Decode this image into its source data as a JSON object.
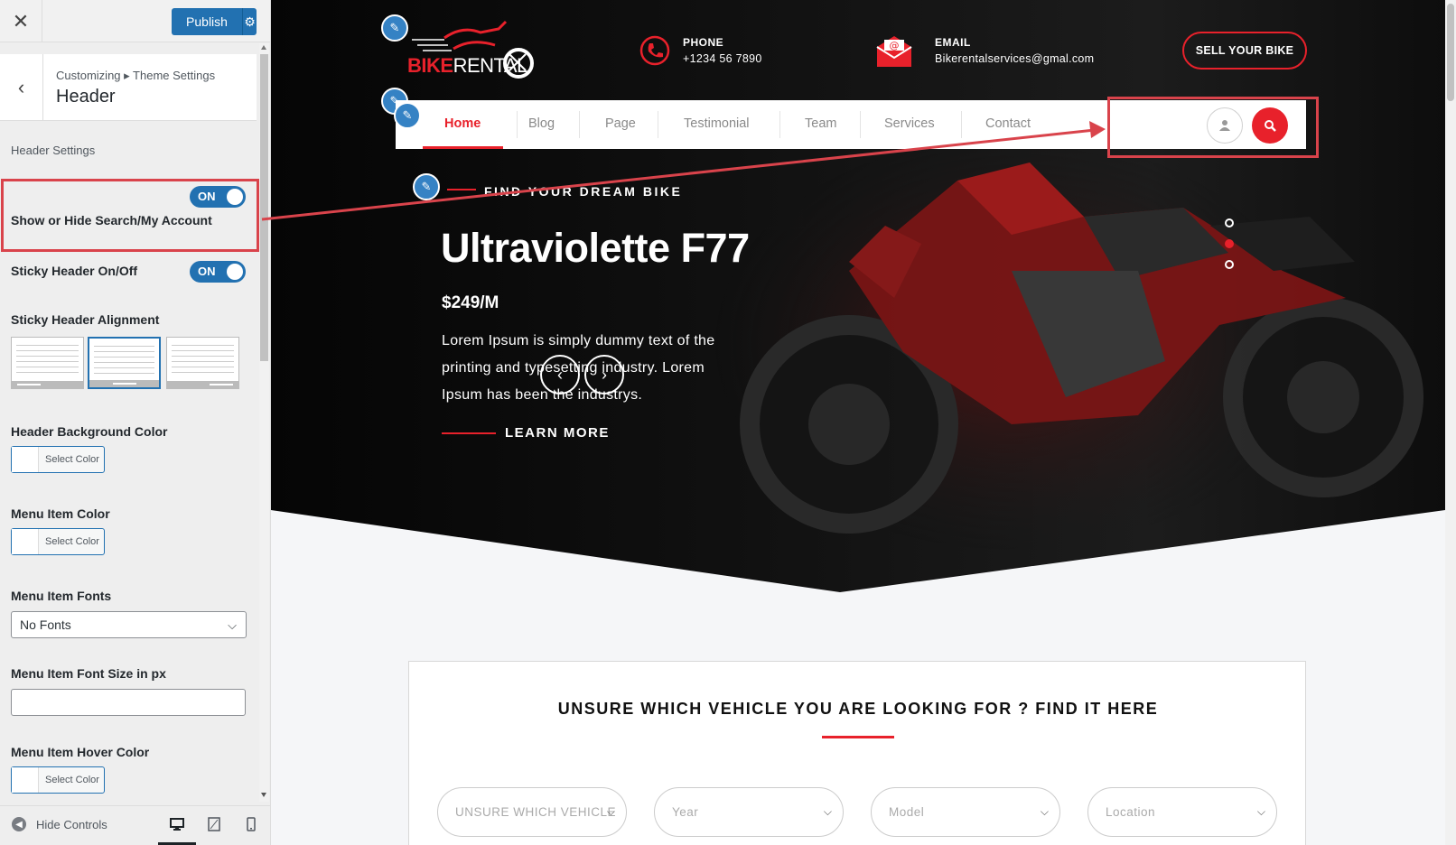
{
  "sidebar": {
    "close_icon": "close-icon",
    "publish_label": "Publish",
    "publish_gear_icon": "gear-icon",
    "breadcrumb": "Customizing ▸ Theme Settings",
    "section_title": "Header",
    "group_label": "Header Settings",
    "show_hide_toggle": {
      "label": "Show or Hide Search/My Account",
      "state": "ON"
    },
    "sticky_toggle": {
      "label": "Sticky Header On/Off",
      "state": "ON"
    },
    "sticky_alignment_label": "Sticky Header Alignment",
    "sticky_alignment_selected": "center",
    "bg_color_label": "Header Background Color",
    "menu_color_label": "Menu Item Color",
    "menu_fonts_label": "Menu Item Fonts",
    "menu_fonts_value": "No Fonts",
    "menu_font_size_label": "Menu Item Font Size in px",
    "menu_font_size_value": "",
    "menu_hover_label": "Menu Item Hover Color",
    "select_color_label": "Select Color",
    "hide_controls_label": "Hide Controls"
  },
  "preview": {
    "logo": {
      "part1": "BIKE",
      "part2": "RENTAL"
    },
    "phone": {
      "label": "PHONE",
      "value": "+1234 56 7890"
    },
    "email": {
      "label": "EMAIL",
      "value": "Bikerentalservices@gmal.com"
    },
    "sell_button": "SELL YOUR BIKE",
    "nav": [
      "Home",
      "Blog",
      "Page",
      "Testimonial",
      "Team",
      "Services",
      "Contact"
    ],
    "nav_active": "Home",
    "hero": {
      "tagline": "FIND YOUR DREAM BIKE",
      "title": "Ultraviolette F77",
      "price": "$249/M",
      "description": "Lorem Ipsum is simply dummy text of the printing and typesetting industry. Lorem Ipsum has been the industrys.",
      "cta": "LEARN MORE",
      "prev_icon": "chevron-left-icon",
      "next_icon": "chevron-right-icon"
    },
    "slider_dots": 3,
    "slider_active_dot": 2,
    "search_section": {
      "title": "UNSURE WHICH VEHICLE YOU ARE LOOKING FOR ? FIND IT HERE",
      "filters": [
        "UNSURE WHICH VEHICLE",
        "Year",
        "Model",
        "Location"
      ]
    }
  },
  "colors": {
    "accent": "#e8212b",
    "wp_blue": "#2271b1",
    "highlight": "#d9434b"
  }
}
